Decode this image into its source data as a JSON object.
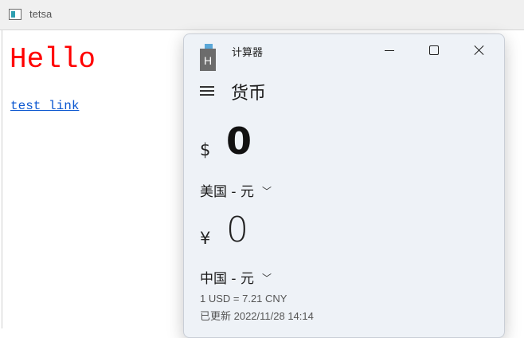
{
  "background_window": {
    "title": "tetsa",
    "heading": "Hello",
    "link_text": "test link",
    "heading_color": "#ff0000",
    "link_color": "#0b57d0"
  },
  "calculator": {
    "title": "计算器",
    "icon_letter": "H",
    "mode_title": "货币",
    "from": {
      "symbol": "$",
      "value": "0",
      "unit": "美国 - 元"
    },
    "to": {
      "symbol": "¥",
      "value": "0",
      "unit": "中国 - 元"
    },
    "rate_text": "1 USD = 7.21 CNY",
    "updated_text": "已更新 2022/11/28 14:14",
    "icons": {
      "menu": "hamburger-menu-icon",
      "minimize": "minimize-icon",
      "maximize": "maximize-icon",
      "close": "close-icon",
      "dropdown": "chevron-down-icon"
    },
    "chevron_glyph": "﹀"
  }
}
